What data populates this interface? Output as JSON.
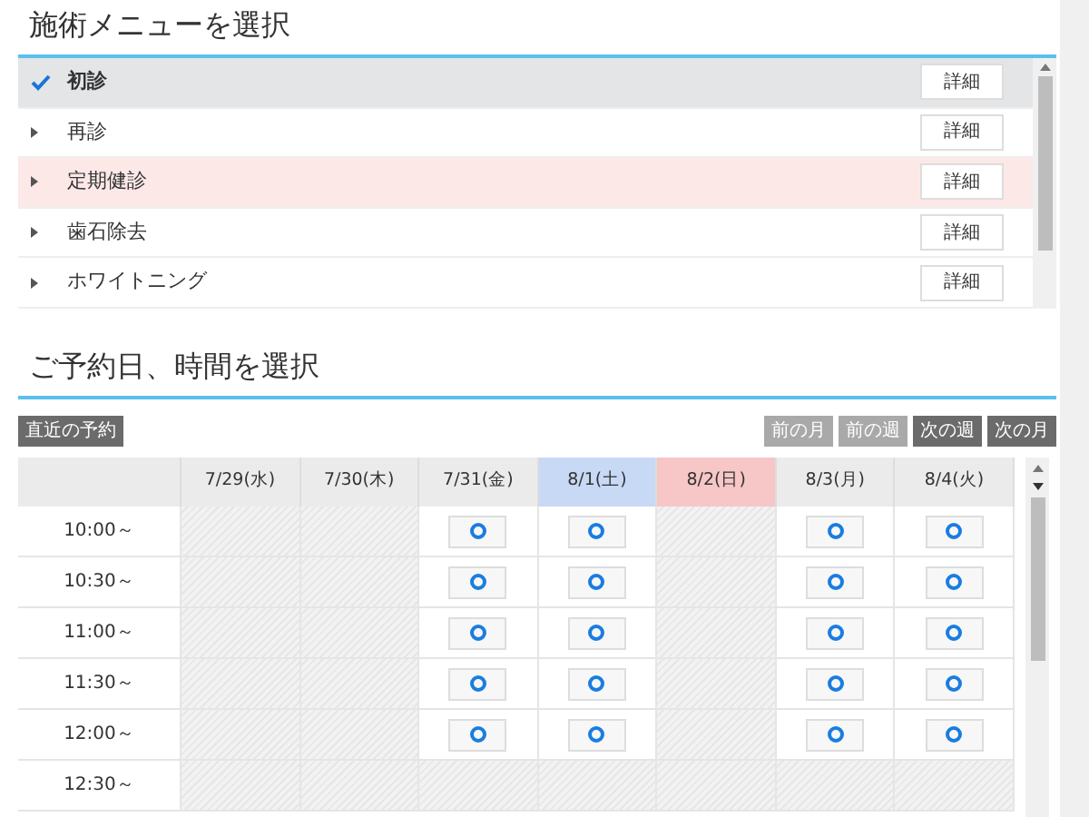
{
  "menu_section": {
    "title": "施術メニューを選択",
    "items": [
      {
        "label": "初診",
        "selected": true,
        "highlighted": false,
        "detail": "詳細"
      },
      {
        "label": "再診",
        "selected": false,
        "highlighted": false,
        "detail": "詳細"
      },
      {
        "label": "定期健診",
        "selected": false,
        "highlighted": true,
        "detail": "詳細"
      },
      {
        "label": "歯石除去",
        "selected": false,
        "highlighted": false,
        "detail": "詳細"
      },
      {
        "label": "ホワイトニング",
        "selected": false,
        "highlighted": false,
        "detail": "詳細"
      }
    ]
  },
  "schedule_section": {
    "title": "ご予約日、時間を選択",
    "nearest_button": "直近の予約",
    "nav_buttons": [
      {
        "label": "前の月",
        "disabled": true
      },
      {
        "label": "前の週",
        "disabled": true
      },
      {
        "label": "次の週",
        "disabled": false
      },
      {
        "label": "次の月",
        "disabled": false
      }
    ],
    "days": [
      {
        "label": "7/29(水)",
        "kind": "weekday"
      },
      {
        "label": "7/30(木)",
        "kind": "weekday"
      },
      {
        "label": "7/31(金)",
        "kind": "weekday"
      },
      {
        "label": "8/1(土)",
        "kind": "saturday"
      },
      {
        "label": "8/2(日)",
        "kind": "sunday"
      },
      {
        "label": "8/3(月)",
        "kind": "weekday"
      },
      {
        "label": "8/4(火)",
        "kind": "weekday"
      }
    ],
    "slots": [
      {
        "time": "10:00～",
        "available": [
          false,
          false,
          true,
          true,
          false,
          true,
          true
        ]
      },
      {
        "time": "10:30～",
        "available": [
          false,
          false,
          true,
          true,
          false,
          true,
          true
        ]
      },
      {
        "time": "11:00～",
        "available": [
          false,
          false,
          true,
          true,
          false,
          true,
          true
        ]
      },
      {
        "time": "11:30～",
        "available": [
          false,
          false,
          true,
          true,
          false,
          true,
          true
        ]
      },
      {
        "time": "12:00～",
        "available": [
          false,
          false,
          true,
          true,
          false,
          true,
          true
        ]
      },
      {
        "time": "12:30～",
        "available": [
          false,
          false,
          false,
          false,
          false,
          false,
          false
        ]
      }
    ]
  }
}
